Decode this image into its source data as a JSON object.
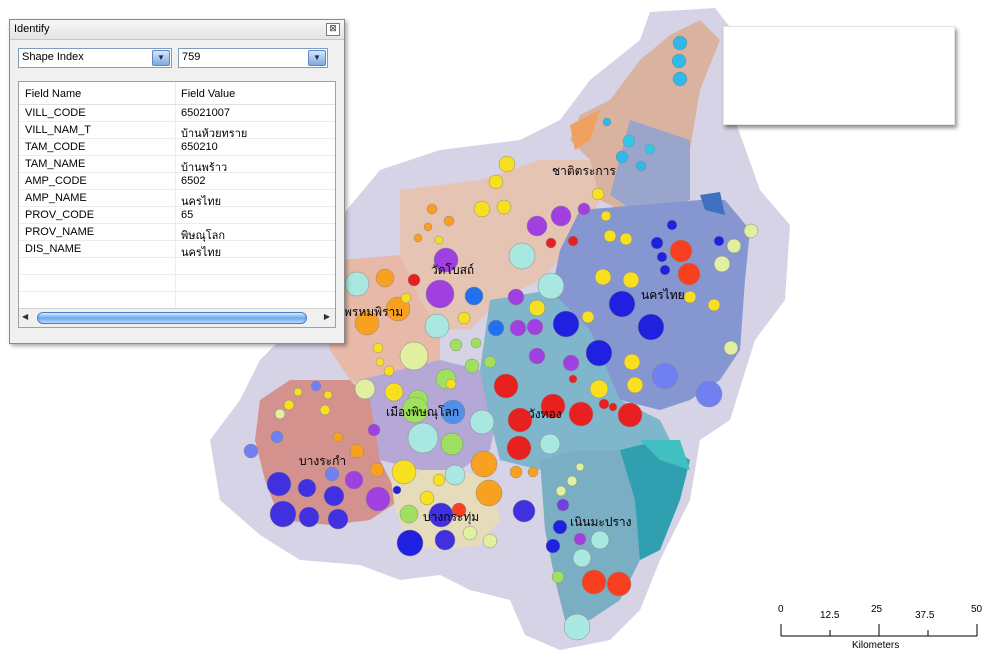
{
  "identify": {
    "title": "Identify",
    "close_glyph": "⊠",
    "layer_dropdown": "Shape Index",
    "feature_dropdown": "759",
    "headers": {
      "field_name": "Field Name",
      "field_value": "Field Value"
    },
    "rows": [
      {
        "name": "VILL_CODE",
        "value": "65021007"
      },
      {
        "name": "VILL_NAM_T",
        "value": "บ้านห้วยทราย"
      },
      {
        "name": "TAM_CODE",
        "value": "650210"
      },
      {
        "name": "TAM_NAME",
        "value": "บ้านพร้าว"
      },
      {
        "name": "AMP_CODE",
        "value": "6502"
      },
      {
        "name": "AMP_NAME",
        "value": "นครไทย"
      },
      {
        "name": "PROV_CODE",
        "value": "65"
      },
      {
        "name": "PROV_NAME",
        "value": "พิษณุโลก"
      },
      {
        "name": "DIS_NAME",
        "value": "นครไทย"
      }
    ]
  },
  "map": {
    "district_labels": [
      "ชาติตระการ",
      "วัดโบสถ์",
      "นครไทย",
      "พรหมพิราม",
      "เมืองพิษณุโลก",
      "วังทอง",
      "บางระกำ",
      "บางกระทุ่ม",
      "เนินมะปราง"
    ]
  },
  "scale_bar": {
    "ticks": [
      "0",
      "12.5",
      "25",
      "37.5",
      "50"
    ],
    "unit": "Kilometers"
  }
}
